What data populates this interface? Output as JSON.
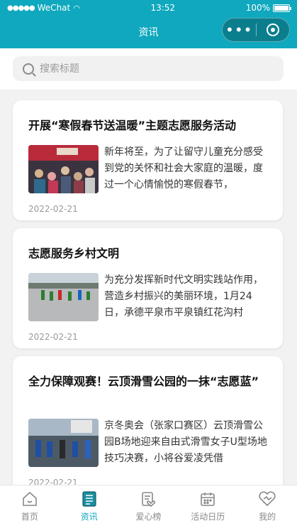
{
  "status_bar": {
    "carrier": "WeChat",
    "time": "13:52",
    "battery": "100%"
  },
  "nav": {
    "title": "资讯",
    "more_icon": "more-dots-icon",
    "close_icon": "target-close-icon"
  },
  "search": {
    "placeholder": "搜索标题",
    "value": ""
  },
  "articles": [
    {
      "title": "开展“寒假春节送温暖”主题志愿服务活动",
      "summary": "新年将至，为了让留守儿童充分感受到党的关怀和社会大家庭的温暖，度过一个心情愉悦的寒假春节，",
      "date": "2022-02-21"
    },
    {
      "title": "志愿服务乡村文明",
      "summary": "为充分发挥新时代文明实践站作用，营造乡村振兴的美丽环境，1月24日，承德平泉市平泉镇红花沟村",
      "date": "2022-02-21"
    },
    {
      "title": "全力保障观赛！云顶滑雪公园的一抹“志愿蓝”",
      "summary": "京冬奥会（张家口赛区）云顶滑雪公园B场地迎来自由式滑雪女子U型场地技巧决赛，小将谷爱凌凭借",
      "date": "2022-02-21"
    }
  ],
  "tabbar": [
    {
      "label": "首页",
      "icon": "home-icon",
      "active": false
    },
    {
      "label": "资讯",
      "icon": "news-icon",
      "active": true
    },
    {
      "label": "爱心榜",
      "icon": "love-list-icon",
      "active": false
    },
    {
      "label": "活动日历",
      "icon": "calendar-icon",
      "active": false
    },
    {
      "label": "我的",
      "icon": "heart-profile-icon",
      "active": false
    }
  ],
  "colors": {
    "accent": "#0fa8be",
    "inactive": "#888888"
  }
}
